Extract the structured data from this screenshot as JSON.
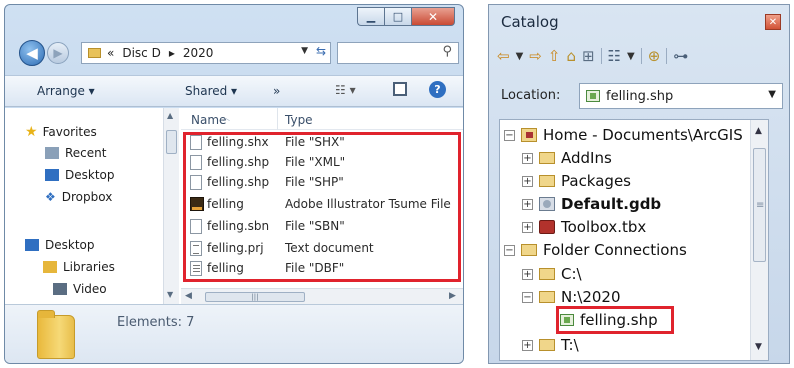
{
  "explorer": {
    "window_buttons": {
      "minimize": "▁",
      "maximize": "□",
      "close": "✕"
    },
    "address": {
      "separator": "«",
      "segments": [
        "Disc D",
        "▸",
        "2020"
      ]
    },
    "toolbar": {
      "arrange": "Arrange ▾",
      "shared": "Shared ▾",
      "more": "»"
    },
    "sidebar": {
      "favorites": "Favorites",
      "recent": "Recent",
      "desktop": "Desktop",
      "dropbox": "Dropbox",
      "desktop2": "Desktop",
      "libraries": "Libraries",
      "video": "Video"
    },
    "columns": {
      "name": "Name",
      "type": "Type"
    },
    "files": [
      {
        "name": "felling.shx",
        "type": "File \"SHX\"",
        "icon": "document-icon"
      },
      {
        "name": "felling.shp",
        "type": "File \"XML\"",
        "icon": "document-icon"
      },
      {
        "name": "felling.shp",
        "type": "File \"SHP\"",
        "icon": "document-icon"
      },
      {
        "name": "felling",
        "type": "Adobe Illustrator Tsume File",
        "icon": "illustrator-file-icon"
      },
      {
        "name": "felling.sbn",
        "type": "File \"SBN\"",
        "icon": "document-icon"
      },
      {
        "name": "felling.prj",
        "type": "Text document",
        "icon": "text-document-icon"
      },
      {
        "name": "felling",
        "type": "File \"DBF\"",
        "icon": "table-document-icon"
      }
    ],
    "details": {
      "elements": "Elements: 7"
    }
  },
  "catalog": {
    "title": "Catalog",
    "location_label": "Location:",
    "location_value": "felling.shp",
    "tree": {
      "home": "Home - Documents\\ArcGIS",
      "addins": "AddIns",
      "packages": "Packages",
      "default_gdb": "Default.gdb",
      "toolbox": "Toolbox.tbx",
      "folder_connections": "Folder Connections",
      "c_drive": "C:\\",
      "n_2020": "N:\\2020",
      "felling_shp": "felling.shp",
      "t_drive": "T:\\"
    }
  },
  "colors": {
    "highlight_red": "#e0232d",
    "window_blue": "#b9d0e9"
  }
}
